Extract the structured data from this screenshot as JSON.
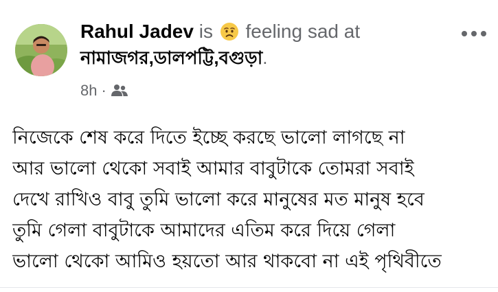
{
  "post": {
    "author": "Rahul Jadev",
    "verb": "is",
    "feeling_icon": "sad-face-emoji",
    "feeling": "feeling sad at",
    "location": "নামাজগর,ডালপট্টি,বগুড়া",
    "location_suffix": ".",
    "time": "8h",
    "separator": "·",
    "audience_icon": "friends-icon",
    "more_icon": "more-options-icon",
    "body_lines": [
      "নিজেকে শেষ করে দিতে ইচ্ছে করছে ভালো লাগছে না",
      "আর ভালো থেকো সবাই আমার বাবুটাকে তোমরা সবাই",
      "দেখে রাখিও বাবু তুমি ভালো করে মানুষের মত মানুষ হবে",
      "তুমি গেলা বাবুটাকে আমাদের এতিম করে দিয়ে গেলা",
      "ভালো থেকো আমিও হয়তো আর থাকবো না এই পৃথিবীতে"
    ]
  },
  "colors": {
    "primary_text": "#050505",
    "secondary_text": "#65676b",
    "emoji_yellow": "#f7c948",
    "divider": "#e4e6eb"
  }
}
